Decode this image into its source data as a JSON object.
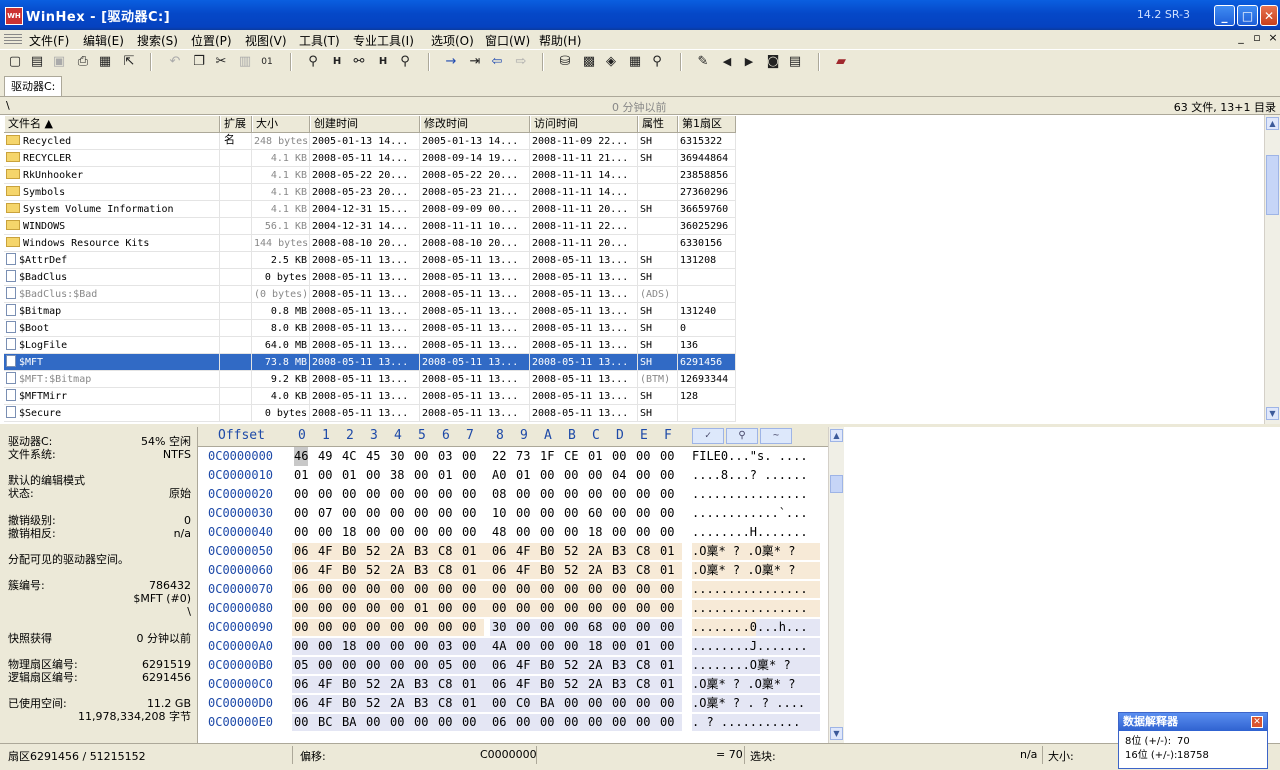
{
  "window": {
    "title": "WinHex - [驱动器C:]",
    "version": "14.2 SR-3",
    "icon_label": "WH",
    "minimize": "_",
    "maximize": "□",
    "close": "✕"
  },
  "menu": [
    "文件(F)",
    "编辑(E)",
    "搜索(S)",
    "位置(P)",
    "视图(V)",
    "工具(T)",
    "专业工具(I)",
    "选项(O)",
    "窗口(W)",
    "帮助(H)"
  ],
  "mdi_controls": [
    "_",
    "▫",
    "×"
  ],
  "toolbar_icons": [
    {
      "name": "new-file-icon",
      "glyph": "▢"
    },
    {
      "name": "open-folder-icon",
      "glyph": "▤"
    },
    {
      "name": "save-icon",
      "glyph": "▣"
    },
    {
      "name": "print-icon",
      "glyph": "⎙"
    },
    {
      "name": "properties-icon",
      "glyph": "▦"
    },
    {
      "name": "export-icon",
      "glyph": "⇱"
    },
    {
      "name": "undo-icon",
      "glyph": "↶"
    },
    {
      "name": "copy-icon",
      "glyph": "❐"
    },
    {
      "name": "cut-icon",
      "glyph": "✂"
    },
    {
      "name": "paste-icon",
      "glyph": "▥"
    },
    {
      "name": "binary-icon",
      "glyph": "01"
    },
    {
      "name": "find-text-icon",
      "glyph": "⚲"
    },
    {
      "name": "find-hex-icon",
      "glyph": "H"
    },
    {
      "name": "replace-text-icon",
      "glyph": "⚯"
    },
    {
      "name": "replace-hex-icon",
      "glyph": "H"
    },
    {
      "name": "find-again-icon",
      "glyph": "⚲"
    },
    {
      "name": "goto-offset-icon",
      "glyph": "→"
    },
    {
      "name": "goto-sector-icon",
      "glyph": "⇥"
    },
    {
      "name": "back-icon",
      "glyph": "⇦"
    },
    {
      "name": "forward-icon",
      "glyph": "⇨"
    },
    {
      "name": "open-disk-icon",
      "glyph": "⛁"
    },
    {
      "name": "open-ram-icon",
      "glyph": "▩"
    },
    {
      "name": "disk-tools-icon",
      "glyph": "◈"
    },
    {
      "name": "calculator-icon",
      "glyph": "▦"
    },
    {
      "name": "analyze-icon",
      "glyph": "⚲"
    },
    {
      "name": "script-icon",
      "glyph": "✎"
    },
    {
      "name": "prev-icon",
      "glyph": "◀"
    },
    {
      "name": "next-icon",
      "glyph": "▶"
    },
    {
      "name": "camera-icon",
      "glyph": "◙"
    },
    {
      "name": "table-icon",
      "glyph": "▤"
    },
    {
      "name": "help-book-icon",
      "glyph": "▰"
    }
  ],
  "tab": {
    "label": "驱动器C:"
  },
  "pathbar": {
    "path": "\\",
    "snapshot": "0 分钟以前",
    "count": "63 文件, 13+1 目录"
  },
  "file_columns": [
    "文件名 ▲",
    "扩展名",
    "大小",
    "创建时间",
    "修改时间",
    "访问时间",
    "属性",
    "第1扇区"
  ],
  "files": [
    {
      "name": "Recycled",
      "type": "folder",
      "gray_name": false,
      "size": "248 bytes",
      "gray_size": true,
      "created": "2005-01-13  14...",
      "modified": "2005-01-13  14...",
      "accessed": "2008-11-09  22...",
      "attr": "SH",
      "sector": "6315322",
      "selected": false
    },
    {
      "name": "RECYCLER",
      "type": "folder",
      "gray_name": false,
      "size": "4.1 KB",
      "gray_size": true,
      "created": "2008-05-11  14...",
      "modified": "2008-09-14  19...",
      "accessed": "2008-11-11  21...",
      "attr": "SH",
      "sector": "36944864",
      "selected": false
    },
    {
      "name": "RkUnhooker",
      "type": "folder",
      "gray_name": false,
      "size": "4.1 KB",
      "gray_size": true,
      "created": "2008-05-22  20...",
      "modified": "2008-05-22  20...",
      "accessed": "2008-11-11  14...",
      "attr": "",
      "sector": "23858856",
      "selected": false
    },
    {
      "name": "Symbols",
      "type": "folder",
      "gray_name": false,
      "size": "4.1 KB",
      "gray_size": true,
      "created": "2008-05-23  20...",
      "modified": "2008-05-23  21...",
      "accessed": "2008-11-11  14...",
      "attr": "",
      "sector": "27360296",
      "selected": false
    },
    {
      "name": "System Volume Information",
      "type": "folder",
      "gray_name": false,
      "size": "4.1 KB",
      "gray_size": true,
      "created": "2004-12-31  15...",
      "modified": "2008-09-09  00...",
      "accessed": "2008-11-11  20...",
      "attr": "SH",
      "sector": "36659760",
      "selected": false
    },
    {
      "name": "WINDOWS",
      "type": "folder",
      "gray_name": false,
      "size": "56.1 KB",
      "gray_size": true,
      "created": "2004-12-31  14...",
      "modified": "2008-11-11  10...",
      "accessed": "2008-11-11  22...",
      "attr": "",
      "sector": "36025296",
      "selected": false
    },
    {
      "name": "Windows Resource Kits",
      "type": "folder",
      "gray_name": false,
      "size": "144 bytes",
      "gray_size": true,
      "created": "2008-08-10  20...",
      "modified": "2008-08-10  20...",
      "accessed": "2008-11-11  20...",
      "attr": "",
      "sector": "6330156",
      "selected": false
    },
    {
      "name": "$AttrDef",
      "type": "file",
      "gray_name": false,
      "size": "2.5 KB",
      "gray_size": false,
      "created": "2008-05-11  13...",
      "modified": "2008-05-11  13...",
      "accessed": "2008-05-11  13...",
      "attr": "SH",
      "sector": "131208",
      "selected": false
    },
    {
      "name": "$BadClus",
      "type": "file",
      "gray_name": false,
      "size": "0 bytes",
      "gray_size": false,
      "created": "2008-05-11  13...",
      "modified": "2008-05-11  13...",
      "accessed": "2008-05-11  13...",
      "attr": "SH",
      "sector": "",
      "selected": false
    },
    {
      "name": "$BadClus:$Bad",
      "type": "file",
      "gray_name": true,
      "size": "(0 bytes)",
      "gray_size": true,
      "created": "2008-05-11  13...",
      "modified": "2008-05-11  13...",
      "accessed": "2008-05-11  13...",
      "attr": "(ADS)",
      "sector": "",
      "selected": false
    },
    {
      "name": "$Bitmap",
      "type": "file",
      "gray_name": false,
      "size": "0.8 MB",
      "gray_size": false,
      "created": "2008-05-11  13...",
      "modified": "2008-05-11  13...",
      "accessed": "2008-05-11  13...",
      "attr": "SH",
      "sector": "131240",
      "selected": false
    },
    {
      "name": "$Boot",
      "type": "file",
      "gray_name": false,
      "size": "8.0 KB",
      "gray_size": false,
      "created": "2008-05-11  13...",
      "modified": "2008-05-11  13...",
      "accessed": "2008-05-11  13...",
      "attr": "SH",
      "sector": "0",
      "selected": false
    },
    {
      "name": "$LogFile",
      "type": "file",
      "gray_name": false,
      "size": "64.0 MB",
      "gray_size": false,
      "created": "2008-05-11  13...",
      "modified": "2008-05-11  13...",
      "accessed": "2008-05-11  13...",
      "attr": "SH",
      "sector": "136",
      "selected": false
    },
    {
      "name": "$MFT",
      "type": "file",
      "gray_name": false,
      "size": "73.8 MB",
      "gray_size": false,
      "created": "2008-05-11  13...",
      "modified": "2008-05-11  13...",
      "accessed": "2008-05-11  13...",
      "attr": "SH",
      "sector": "6291456",
      "selected": true
    },
    {
      "name": "$MFT:$Bitmap",
      "type": "file",
      "gray_name": true,
      "size": "9.2 KB",
      "gray_size": false,
      "created": "2008-05-11  13...",
      "modified": "2008-05-11  13...",
      "accessed": "2008-05-11  13...",
      "attr": "(BTM)",
      "sector": "12693344",
      "selected": false
    },
    {
      "name": "$MFTMirr",
      "type": "file",
      "gray_name": false,
      "size": "4.0 KB",
      "gray_size": false,
      "created": "2008-05-11  13...",
      "modified": "2008-05-11  13...",
      "accessed": "2008-05-11  13...",
      "attr": "SH",
      "sector": "128",
      "selected": false
    },
    {
      "name": "$Secure",
      "type": "file",
      "gray_name": false,
      "size": "0 bytes",
      "gray_size": false,
      "created": "2008-05-11  13...",
      "modified": "2008-05-11  13...",
      "accessed": "2008-05-11  13...",
      "attr": "SH",
      "sector": "",
      "selected": false
    }
  ],
  "info": [
    {
      "label": "驱动器C:",
      "value": "54% 空闲"
    },
    {
      "label": "文件系统:",
      "value": "NTFS"
    },
    {
      "label": "",
      "value": ""
    },
    {
      "label": "默认的编辑模式",
      "value": ""
    },
    {
      "label": "状态:",
      "value": "原始"
    },
    {
      "label": "",
      "value": ""
    },
    {
      "label": "撤销级别:",
      "value": "0"
    },
    {
      "label": "撤销相反:",
      "value": "n/a"
    },
    {
      "label": "",
      "value": ""
    },
    {
      "label": "分配可见的驱动器空间。",
      "value": ""
    },
    {
      "label": "",
      "value": ""
    },
    {
      "label": "簇编号:",
      "value": "786432"
    },
    {
      "label": "",
      "value": "$MFT (#0)"
    },
    {
      "label": "",
      "value": "\\"
    },
    {
      "label": "",
      "value": ""
    },
    {
      "label": "快照获得",
      "value": "0 分钟以前"
    },
    {
      "label": "",
      "value": ""
    },
    {
      "label": "物理扇区编号:",
      "value": "6291519"
    },
    {
      "label": "逻辑扇区编号:",
      "value": "6291456"
    },
    {
      "label": "",
      "value": ""
    },
    {
      "label": "已使用空间:",
      "value": "11.2 GB"
    },
    {
      "label": "",
      "value": "11,978,334,208 字节"
    }
  ],
  "hex": {
    "offset_label": "Offset",
    "col_labels": [
      "0",
      "1",
      "2",
      "3",
      "4",
      "5",
      "6",
      "7",
      "8",
      "9",
      "A",
      "B",
      "C",
      "D",
      "E",
      "F"
    ],
    "rows": [
      {
        "off": "0C0000000",
        "bytes": [
          "46",
          "49",
          "4C",
          "45",
          "30",
          "00",
          "03",
          "00",
          "22",
          "73",
          "1F",
          "CE",
          "01",
          "00",
          "00",
          "00"
        ],
        "text": "FILE0...\"s. ...."
      },
      {
        "off": "0C0000010",
        "bytes": [
          "01",
          "00",
          "01",
          "00",
          "38",
          "00",
          "01",
          "00",
          "A0",
          "01",
          "00",
          "00",
          "00",
          "04",
          "00",
          "00"
        ],
        "text": "....8...? ......"
      },
      {
        "off": "0C0000020",
        "bytes": [
          "00",
          "00",
          "00",
          "00",
          "00",
          "00",
          "00",
          "00",
          "08",
          "00",
          "00",
          "00",
          "00",
          "00",
          "00",
          "00"
        ],
        "text": "................"
      },
      {
        "off": "0C0000030",
        "bytes": [
          "00",
          "07",
          "00",
          "00",
          "00",
          "00",
          "00",
          "00",
          "10",
          "00",
          "00",
          "00",
          "60",
          "00",
          "00",
          "00"
        ],
        "text": "............`..."
      },
      {
        "off": "0C0000040",
        "bytes": [
          "00",
          "00",
          "18",
          "00",
          "00",
          "00",
          "00",
          "00",
          "48",
          "00",
          "00",
          "00",
          "18",
          "00",
          "00",
          "00"
        ],
        "text": "........H......."
      },
      {
        "off": "0C0000050",
        "bytes": [
          "06",
          "4F",
          "B0",
          "52",
          "2A",
          "B3",
          "C8",
          "01",
          "06",
          "4F",
          "B0",
          "52",
          "2A",
          "B3",
          "C8",
          "01"
        ],
        "text": ".O稟* ? .O稟* ?"
      },
      {
        "off": "0C0000060",
        "bytes": [
          "06",
          "4F",
          "B0",
          "52",
          "2A",
          "B3",
          "C8",
          "01",
          "06",
          "4F",
          "B0",
          "52",
          "2A",
          "B3",
          "C8",
          "01"
        ],
        "text": ".O稟* ? .O稟* ?"
      },
      {
        "off": "0C0000070",
        "bytes": [
          "06",
          "00",
          "00",
          "00",
          "00",
          "00",
          "00",
          "00",
          "00",
          "00",
          "00",
          "00",
          "00",
          "00",
          "00",
          "00"
        ],
        "text": "................"
      },
      {
        "off": "0C0000080",
        "bytes": [
          "00",
          "00",
          "00",
          "00",
          "00",
          "01",
          "00",
          "00",
          "00",
          "00",
          "00",
          "00",
          "00",
          "00",
          "00",
          "00"
        ],
        "text": "................"
      },
      {
        "off": "0C0000090",
        "bytes": [
          "00",
          "00",
          "00",
          "00",
          "00",
          "00",
          "00",
          "00",
          "30",
          "00",
          "00",
          "00",
          "68",
          "00",
          "00",
          "00"
        ],
        "text": "........0...h..."
      },
      {
        "off": "0C00000A0",
        "bytes": [
          "00",
          "00",
          "18",
          "00",
          "00",
          "00",
          "03",
          "00",
          "4A",
          "00",
          "00",
          "00",
          "18",
          "00",
          "01",
          "00"
        ],
        "text": "........J......."
      },
      {
        "off": "0C00000B0",
        "bytes": [
          "05",
          "00",
          "00",
          "00",
          "00",
          "00",
          "05",
          "00",
          "06",
          "4F",
          "B0",
          "52",
          "2A",
          "B3",
          "C8",
          "01"
        ],
        "text": "........O稟* ?"
      },
      {
        "off": "0C00000C0",
        "bytes": [
          "06",
          "4F",
          "B0",
          "52",
          "2A",
          "B3",
          "C8",
          "01",
          "06",
          "4F",
          "B0",
          "52",
          "2A",
          "B3",
          "C8",
          "01"
        ],
        "text": ".O稟* ? .O稟* ?"
      },
      {
        "off": "0C00000D0",
        "bytes": [
          "06",
          "4F",
          "B0",
          "52",
          "2A",
          "B3",
          "C8",
          "01",
          "00",
          "C0",
          "BA",
          "00",
          "00",
          "00",
          "00",
          "00"
        ],
        "text": ".O稟* ? . ? ...."
      },
      {
        "off": "0C00000E0",
        "bytes": [
          "00",
          "BC",
          "BA",
          "00",
          "00",
          "00",
          "00",
          "00",
          "06",
          "00",
          "00",
          "00",
          "00",
          "00",
          "00",
          "00"
        ],
        "text": ". ? ..........."
      }
    ],
    "bands": [
      {
        "row": 5,
        "from": 0,
        "to": 16,
        "color": "#f7ead7"
      },
      {
        "row": 6,
        "from": 0,
        "to": 16,
        "color": "#f7ead7"
      },
      {
        "row": 7,
        "from": 0,
        "to": 16,
        "color": "#f7ead7"
      },
      {
        "row": 8,
        "from": 0,
        "to": 16,
        "color": "#f7ead7"
      },
      {
        "row": 9,
        "from": 0,
        "to": 8,
        "color": "#f7ead7"
      },
      {
        "row": 9,
        "from": 8,
        "to": 16,
        "color": "#e4e6f4"
      },
      {
        "row": 10,
        "from": 0,
        "to": 16,
        "color": "#e4e6f4"
      },
      {
        "row": 11,
        "from": 0,
        "to": 16,
        "color": "#e4e6f4"
      },
      {
        "row": 12,
        "from": 0,
        "to": 16,
        "color": "#e4e6f4"
      },
      {
        "row": 13,
        "from": 0,
        "to": 16,
        "color": "#e4e6f4"
      },
      {
        "row": 14,
        "from": 0,
        "to": 16,
        "color": "#e4e6f4"
      }
    ]
  },
  "hex_buttons": [
    "✓",
    "⚲",
    "~"
  ],
  "status": {
    "sector": "扇区6291456 / 51215152",
    "offset_label": "偏移:",
    "offset_value": "C0000000",
    "value": "= 70",
    "block_label": "选块:",
    "na": "n/a",
    "size_label": "大小:"
  },
  "interpreter": {
    "title": "数据解释器",
    "close": "✕",
    "rows": [
      {
        "label": "8位 (+/-):",
        "value": "70"
      },
      {
        "label": "16位 (+/-):",
        "value": "18758"
      }
    ]
  },
  "colors": {
    "selected": "#316ac5",
    "accent": "#0548c8",
    "offset_blue": "#1e4aa8"
  }
}
